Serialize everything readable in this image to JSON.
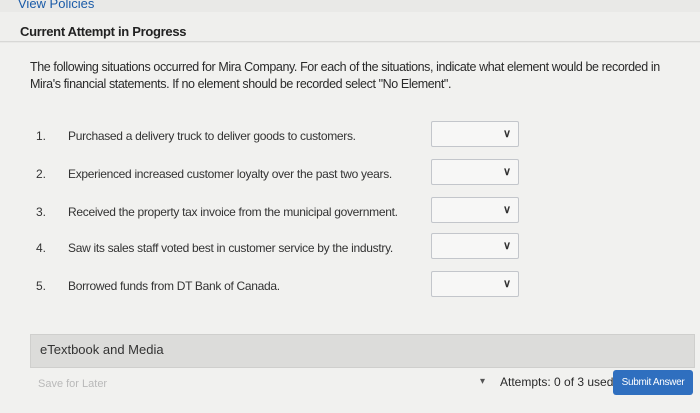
{
  "header": {
    "view_policies": "View Policies",
    "attempt_status": "Current Attempt in Progress"
  },
  "instructions": "The following situations occurred for Mira Company. For each of the situations, indicate what element would be recorded in Mira's financial statements. If no element should be recorded select \"No Element\".",
  "questions": [
    {
      "num": "1.",
      "text": "Purchased a delivery truck to deliver goods to customers.",
      "selected": ""
    },
    {
      "num": "2.",
      "text": "Experienced increased customer loyalty over the past two years.",
      "selected": ""
    },
    {
      "num": "3.",
      "text": "Received the property tax invoice from the municipal government.",
      "selected": ""
    },
    {
      "num": "4.",
      "text": "Saw its sales staff voted best in customer service by the industry.",
      "selected": ""
    },
    {
      "num": "5.",
      "text": "Borrowed funds from DT Bank of Canada.",
      "selected": ""
    }
  ],
  "etextbook": "eTextbook and Media",
  "footer": {
    "save_for_later": "Save for Later",
    "attempts": "Attempts: 0 of 3 used",
    "submit": "Submit Answer"
  },
  "colors": {
    "link": "#1a5ba8",
    "submit_bg": "#2f6fbf"
  }
}
